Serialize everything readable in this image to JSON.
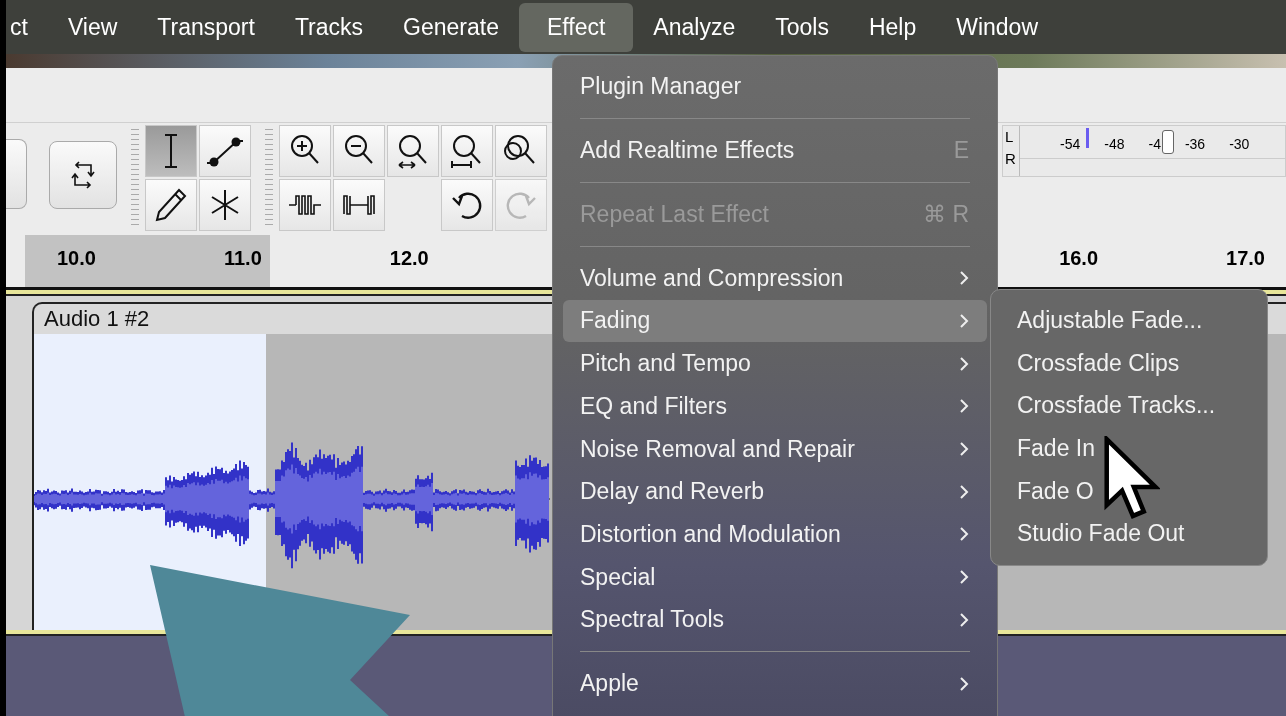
{
  "menu_bar": {
    "items": [
      {
        "label": "ct",
        "selected": false
      },
      {
        "label": "View",
        "selected": false
      },
      {
        "label": "Transport",
        "selected": false
      },
      {
        "label": "Tracks",
        "selected": false
      },
      {
        "label": "Generate",
        "selected": false
      },
      {
        "label": "Effect",
        "selected": true
      },
      {
        "label": "Analyze",
        "selected": false
      },
      {
        "label": "Tools",
        "selected": false
      },
      {
        "label": "Help",
        "selected": false
      },
      {
        "label": "Window",
        "selected": false
      }
    ]
  },
  "tools": [
    {
      "selected": true
    },
    {
      "selected": false
    },
    {
      "selected": false
    },
    {
      "selected": false
    }
  ],
  "edit_buttons": [
    {
      "disabled": false
    },
    {
      "disabled": false
    },
    {
      "disabled": false
    },
    {
      "disabled": false
    },
    {
      "disabled": false
    },
    {
      "disabled": false
    },
    {
      "disabled": false
    },
    {
      "disabled": false
    },
    {
      "disabled": true
    }
  ],
  "meter": {
    "channels": [
      "L",
      "R"
    ],
    "scale": [
      "-54",
      "-48",
      "-4",
      "-36",
      "-30"
    ]
  },
  "ruler": {
    "labels": [
      "10.0",
      "11.0",
      "12.0",
      "16.0",
      "17.0"
    ]
  },
  "track": {
    "clip_name": "Audio 1 #2"
  },
  "effect_menu": {
    "items": [
      {
        "kind": "item",
        "label": "Plugin Manager",
        "disabled": false,
        "submenu": false,
        "selected": false
      },
      {
        "kind": "separator"
      },
      {
        "kind": "item",
        "label": "Add Realtime Effects",
        "shortcut": "E",
        "disabled": false,
        "submenu": false,
        "selected": false
      },
      {
        "kind": "separator"
      },
      {
        "kind": "item",
        "label": "Repeat Last Effect",
        "shortcut": "⌘ R",
        "disabled": true,
        "submenu": false,
        "selected": false
      },
      {
        "kind": "separator"
      },
      {
        "kind": "item",
        "label": "Volume and Compression",
        "disabled": false,
        "submenu": true,
        "selected": false
      },
      {
        "kind": "item",
        "label": "Fading",
        "disabled": false,
        "submenu": true,
        "selected": true
      },
      {
        "kind": "item",
        "label": "Pitch and Tempo",
        "disabled": false,
        "submenu": true,
        "selected": false
      },
      {
        "kind": "item",
        "label": "EQ and Filters",
        "disabled": false,
        "submenu": true,
        "selected": false
      },
      {
        "kind": "item",
        "label": "Noise Removal and Repair",
        "disabled": false,
        "submenu": true,
        "selected": false
      },
      {
        "kind": "item",
        "label": "Delay and Reverb",
        "disabled": false,
        "submenu": true,
        "selected": false
      },
      {
        "kind": "item",
        "label": "Distortion and Modulation",
        "disabled": false,
        "submenu": true,
        "selected": false
      },
      {
        "kind": "item",
        "label": "Special",
        "disabled": false,
        "submenu": true,
        "selected": false
      },
      {
        "kind": "item",
        "label": "Spectral Tools",
        "disabled": false,
        "submenu": true,
        "selected": false
      },
      {
        "kind": "separator"
      },
      {
        "kind": "item",
        "label": "Apple",
        "disabled": false,
        "submenu": true,
        "selected": false
      }
    ]
  },
  "fading_submenu": {
    "items": [
      "Adjustable Fade...",
      "Crossfade Clips",
      "Crossfade Tracks...",
      "Fade In",
      "Fade O",
      "Studio Fade Out"
    ]
  }
}
